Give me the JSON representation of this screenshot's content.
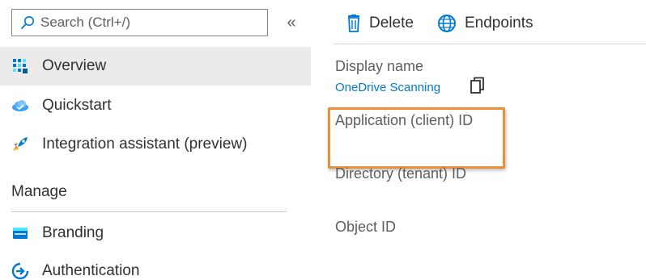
{
  "search": {
    "placeholder": "Search (Ctrl+/)",
    "value": ""
  },
  "nav": {
    "collapse_glyph": "«",
    "items": [
      {
        "label": "Overview",
        "icon": "overview-grid-icon",
        "selected": true
      },
      {
        "label": "Quickstart",
        "icon": "cloud-quickstart-icon"
      },
      {
        "label": "Integration assistant (preview)",
        "icon": "rocket-icon"
      }
    ],
    "manage_header": "Manage",
    "manage_items": [
      {
        "label": "Branding",
        "icon": "branding-icon"
      },
      {
        "label": "Authentication",
        "icon": "authentication-icon"
      }
    ]
  },
  "toolbar": {
    "delete_label": "Delete",
    "endpoints_label": "Endpoints"
  },
  "essentials": {
    "display_name_label": "Display name",
    "display_name_value": "OneDrive Scanning",
    "application_id_label": "Application (client) ID",
    "directory_id_label": "Directory (tenant) ID",
    "object_id_label": "Object ID"
  },
  "colors": {
    "accent": "#0078d4",
    "highlight": "#e8913a",
    "selected_bg": "#edebe9"
  }
}
